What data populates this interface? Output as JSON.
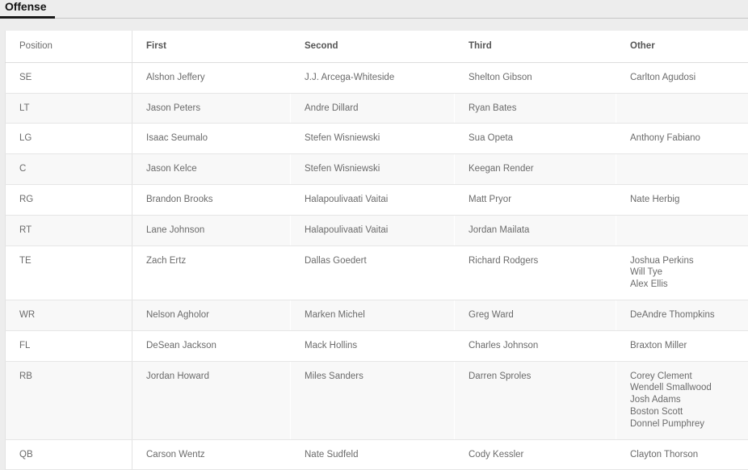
{
  "tabs": [
    {
      "label": "Offense",
      "active": true
    }
  ],
  "table": {
    "name": "depth-chart",
    "columns": [
      {
        "key": "position",
        "label": "Position",
        "bold": false
      },
      {
        "key": "first",
        "label": "First",
        "bold": true
      },
      {
        "key": "second",
        "label": "Second",
        "bold": true
      },
      {
        "key": "third",
        "label": "Third",
        "bold": true
      },
      {
        "key": "other",
        "label": "Other",
        "bold": true
      }
    ],
    "rows": [
      {
        "position": "SE",
        "first": "Alshon Jeffery",
        "second": "J.J. Arcega-Whiteside",
        "third": "Shelton Gibson",
        "other": [
          "Carlton Agudosi"
        ]
      },
      {
        "position": "LT",
        "first": "Jason Peters",
        "second": "Andre Dillard",
        "third": "Ryan Bates",
        "other": []
      },
      {
        "position": "LG",
        "first": "Isaac Seumalo",
        "second": "Stefen Wisniewski",
        "third": "Sua Opeta",
        "other": [
          "Anthony Fabiano"
        ]
      },
      {
        "position": "C",
        "first": "Jason Kelce",
        "second": "Stefen Wisniewski",
        "third": "Keegan Render",
        "other": []
      },
      {
        "position": "RG",
        "first": "Brandon Brooks",
        "second": "Halapoulivaati Vaitai",
        "third": "Matt Pryor",
        "other": [
          "Nate Herbig"
        ]
      },
      {
        "position": "RT",
        "first": "Lane Johnson",
        "second": "Halapoulivaati Vaitai",
        "third": "Jordan Mailata",
        "other": []
      },
      {
        "position": "TE",
        "first": "Zach Ertz",
        "second": "Dallas Goedert",
        "third": "Richard Rodgers",
        "other": [
          "Joshua Perkins",
          "Will Tye",
          "Alex Ellis"
        ]
      },
      {
        "position": "WR",
        "first": "Nelson Agholor",
        "second": "Marken Michel",
        "third": "Greg Ward",
        "other": [
          "DeAndre Thompkins"
        ]
      },
      {
        "position": "FL",
        "first": "DeSean Jackson",
        "second": "Mack Hollins",
        "third": "Charles Johnson",
        "other": [
          "Braxton Miller"
        ]
      },
      {
        "position": "RB",
        "first": "Jordan Howard",
        "second": "Miles Sanders",
        "third": "Darren Sproles",
        "other": [
          "Corey Clement",
          "Wendell Smallwood",
          "Josh Adams",
          "Boston Scott",
          "Donnel Pumphrey"
        ]
      },
      {
        "position": "QB",
        "first": "Carson Wentz",
        "second": "Nate Sudfeld",
        "third": "Cody Kessler",
        "other": [
          "Clayton Thorson"
        ]
      }
    ]
  },
  "colors": {
    "page_background": "#ededed",
    "table_background": "#ffffff",
    "stripe_background": "#f8f8f8",
    "text": "#6b6b6b",
    "header_text": "#555555",
    "tab_text": "#141414",
    "tab_underline": "#1a1a1a",
    "border": "#e6e6e6"
  }
}
